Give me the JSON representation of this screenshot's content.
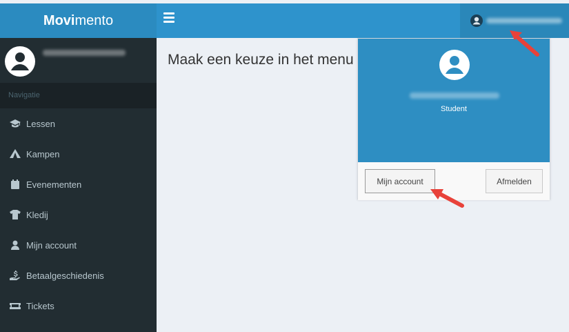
{
  "app": {
    "logo_bold": "Movi",
    "logo_rest": "mento"
  },
  "sidebar": {
    "header": "Navigatie",
    "items": [
      {
        "label": "Lessen",
        "icon": "graduation-cap-icon"
      },
      {
        "label": "Kampen",
        "icon": "tent-icon"
      },
      {
        "label": "Evenementen",
        "icon": "calendar-icon"
      },
      {
        "label": "Kledij",
        "icon": "tshirt-icon"
      },
      {
        "label": "Mijn account",
        "icon": "user-icon"
      },
      {
        "label": "Betaalgeschiedenis",
        "icon": "hand-dollar-icon"
      },
      {
        "label": "Tickets",
        "icon": "ticket-icon"
      }
    ]
  },
  "main": {
    "title": "Maak een keuze in het menu"
  },
  "dropdown": {
    "role": "Student",
    "account_button": "Mijn account",
    "logout_button": "Afmelden"
  },
  "colors": {
    "topbar": "#2e93cc",
    "logo_bg": "#2b8bc0",
    "sidebar": "#222d32",
    "arrow": "#e8423a"
  }
}
